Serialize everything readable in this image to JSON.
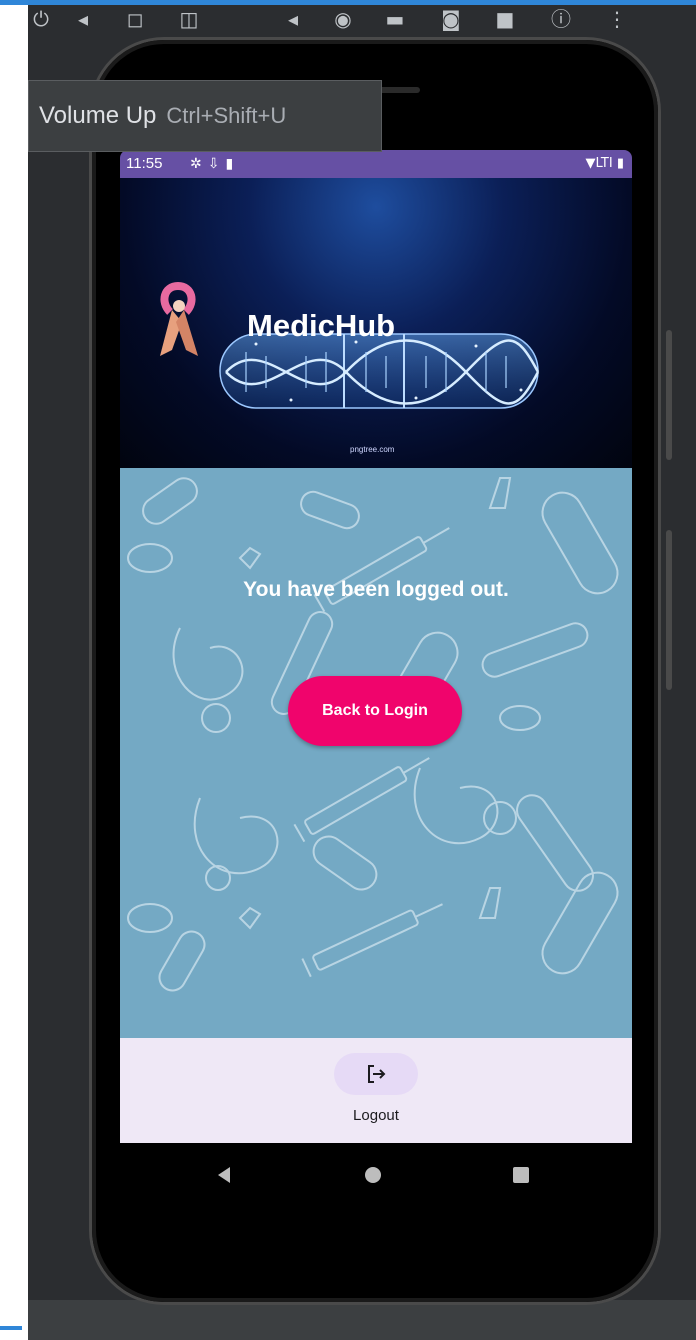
{
  "emulator": {
    "toolbar_icons": [
      "power-icon",
      "volume-up-icon",
      "volume-down-icon",
      "rotate-left-icon",
      "rotate-right-icon",
      "screenshot-icon",
      "camera-icon",
      "more-icon"
    ],
    "tooltip": {
      "label": "Volume Up",
      "shortcut": "Ctrl+Shift+U"
    },
    "accent_color": "#2f86d8"
  },
  "status_bar": {
    "time": "11:55",
    "icons": [
      "settings-icon",
      "download-icon",
      "sd-card-icon"
    ],
    "right": "▼LTI ▮",
    "color": "#6650a4"
  },
  "banner": {
    "title": "MedicHub",
    "credit": "pngtree.com"
  },
  "main": {
    "message": "You have been logged out.",
    "back_button": "Back to Login",
    "button_color": "#f0046c",
    "background_color": "#74a9c4"
  },
  "bottom_nav": {
    "items": [
      {
        "label": "Logout",
        "icon": "logout-icon"
      }
    ]
  },
  "system_nav": [
    "back-icon",
    "home-icon",
    "recents-icon"
  ]
}
